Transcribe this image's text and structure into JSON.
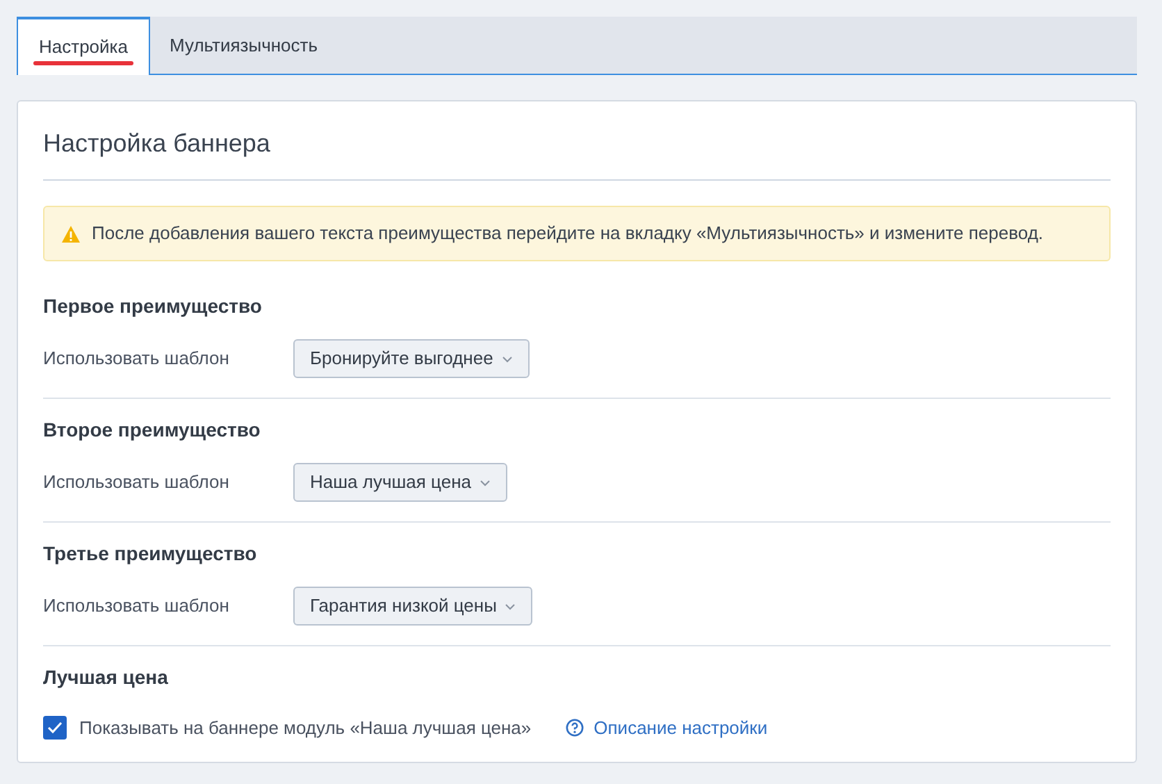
{
  "tabs": [
    {
      "label": "Настройка",
      "selected": true
    },
    {
      "label": "Мультиязычность",
      "selected": false
    }
  ],
  "card": {
    "title": "Настройка баннера",
    "alert": {
      "kind": "warning",
      "text": "После добавления вашего текста преимущества перейдите на вкладку «Мультиязычность» и измените перевод."
    },
    "sections": [
      {
        "heading": "Первое преимущество",
        "kind": "select",
        "label": "Использовать шаблон",
        "value": "Бронируйте выгоднее"
      },
      {
        "heading": "Второе преимущество",
        "kind": "select",
        "label": "Использовать шаблон",
        "value": "Наша лучшая цена"
      },
      {
        "heading": "Третье преимущество",
        "kind": "select",
        "label": "Использовать шаблон",
        "value": "Гарантия низкой цены"
      },
      {
        "heading": "Лучшая цена",
        "kind": "checkbox",
        "label": "Показывать на баннере модуль «Наша лучшая цена»",
        "checked": true,
        "help_link": "Описание настройки"
      }
    ]
  }
}
